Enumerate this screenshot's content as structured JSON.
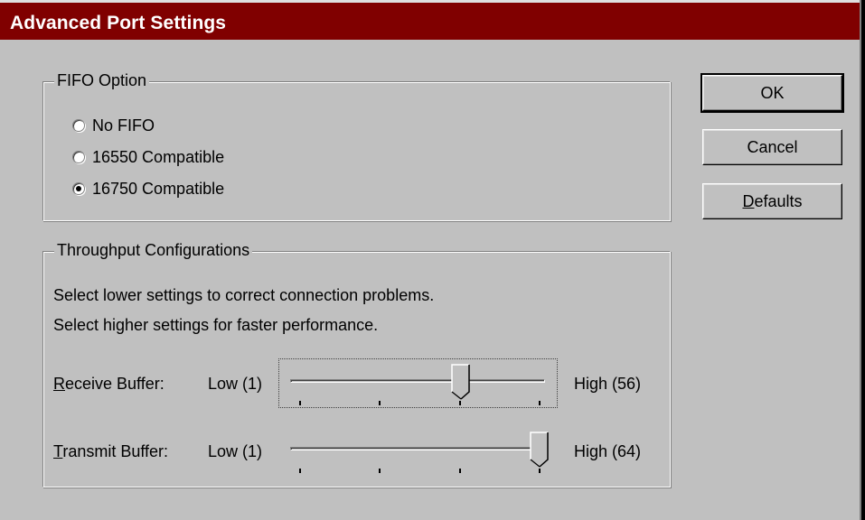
{
  "window": {
    "title": "Advanced Port Settings"
  },
  "fifo": {
    "group_label": "FIFO Option",
    "options": [
      {
        "label": "No FIFO",
        "selected": false
      },
      {
        "label": "16550 Compatible",
        "selected": false
      },
      {
        "label": "16750 Compatible",
        "selected": true
      }
    ]
  },
  "buttons": {
    "ok": "OK",
    "cancel": "Cancel",
    "defaults_first": "D",
    "defaults_rest": "efaults"
  },
  "throughput": {
    "group_label": "Throughput Configurations",
    "line1": "Select lower settings to correct connection problems.",
    "line2": "Select higher settings for faster performance.",
    "receive": {
      "label_first": "R",
      "label_rest": "eceive Buffer:",
      "low": "Low (1)",
      "high": "High (56)",
      "level_fraction": 0.67
    },
    "transmit": {
      "label_first": "T",
      "label_rest": "ransmit Buffer:",
      "low": "Low (1)",
      "high": "High (64)",
      "level_fraction": 1.0
    }
  },
  "colors": {
    "titlebar": "#800000",
    "face": "#c0c0c0"
  }
}
